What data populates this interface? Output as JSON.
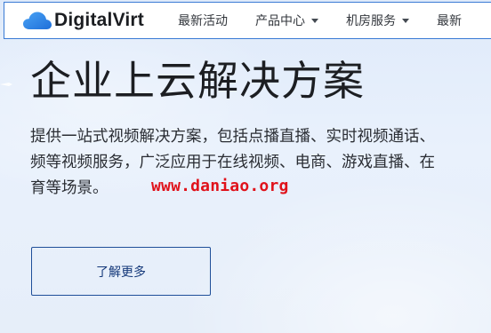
{
  "brand": {
    "name": "DigitalVirt",
    "logo_icon": "cloud-icon",
    "accent_color": "#2b7fe0"
  },
  "nav": {
    "items": [
      {
        "label": "最新活动",
        "dropdown": false
      },
      {
        "label": "产品中心",
        "dropdown": true
      },
      {
        "label": "机房服务",
        "dropdown": true
      },
      {
        "label": "最新",
        "dropdown": false
      }
    ]
  },
  "hero": {
    "title": "企业上云解决方案",
    "description_lines": [
      "提供一站式视频解决方案，包括点播直播、实时视频通话、",
      "频等视频服务，广泛应用于在线视频、电商、游戏直播、在",
      "育等场景。"
    ],
    "cta_label": "了解更多"
  },
  "watermark": {
    "text": "www.daniao.org",
    "color": "#e0121b"
  }
}
